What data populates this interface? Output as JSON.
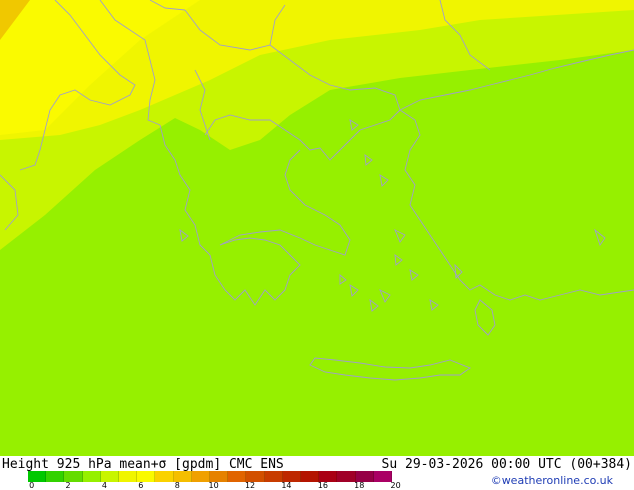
{
  "map": {
    "product_label": "Height 925 hPa mean+σ [gpdm] CMC ENS",
    "valid_time": "Su 29-03-2026 00:00 UTC (00+384)",
    "credit": "©weatheronline.co.uk",
    "field_colors": {
      "sea_main": "#96f000",
      "light_band": "#c8f500",
      "yellow_band": "#f0f500",
      "yellow_corner": "#fafa00",
      "orange_corner": "#f0c800",
      "coast_line": "#a0a0c8"
    }
  },
  "legend": {
    "colors": [
      "#00c800",
      "#32d200",
      "#64dc00",
      "#96f000",
      "#c8f500",
      "#f0f500",
      "#fafa00",
      "#fad200",
      "#f5be00",
      "#f0a000",
      "#e68200",
      "#e16400",
      "#d25000",
      "#c83c00",
      "#be2800",
      "#b41400",
      "#aa0014",
      "#a00028",
      "#960046",
      "#aa0064"
    ],
    "tick_labels": [
      "0",
      "2",
      "4",
      "6",
      "8",
      "10",
      "12",
      "14",
      "16",
      "18",
      "20"
    ]
  }
}
